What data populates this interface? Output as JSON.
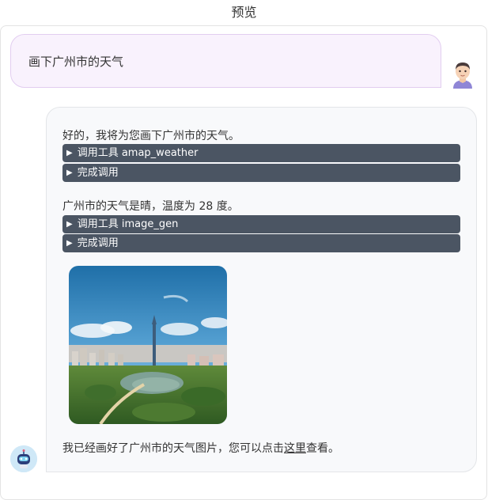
{
  "header": {
    "title": "预览"
  },
  "user_message": {
    "text": "画下广州市的天气"
  },
  "bot_message": {
    "intro": "好的，我将为您画下广州市的天气。",
    "tool_call_1": {
      "arrow": "▶",
      "label": "调用工具 amap_weather"
    },
    "tool_done_1": {
      "arrow": "▶",
      "label": "完成调用"
    },
    "weather_result": "广州市的天气是晴，温度为 28 度。",
    "tool_call_2": {
      "arrow": "▶",
      "label": "调用工具 image_gen"
    },
    "tool_done_2": {
      "arrow": "▶",
      "label": "完成调用"
    },
    "final_prefix": "我已经画好了广州市的天气图片，您可以点击",
    "final_link": "这里",
    "final_suffix": "查看。"
  },
  "colors": {
    "user_bubble_bg": "#f9f2fd",
    "bot_bubble_bg": "#f8f9fb",
    "tool_bar_bg": "#4b5563"
  },
  "icons": {
    "user_avatar": "user-avatar-icon",
    "bot_avatar": "robot-avatar-icon"
  }
}
